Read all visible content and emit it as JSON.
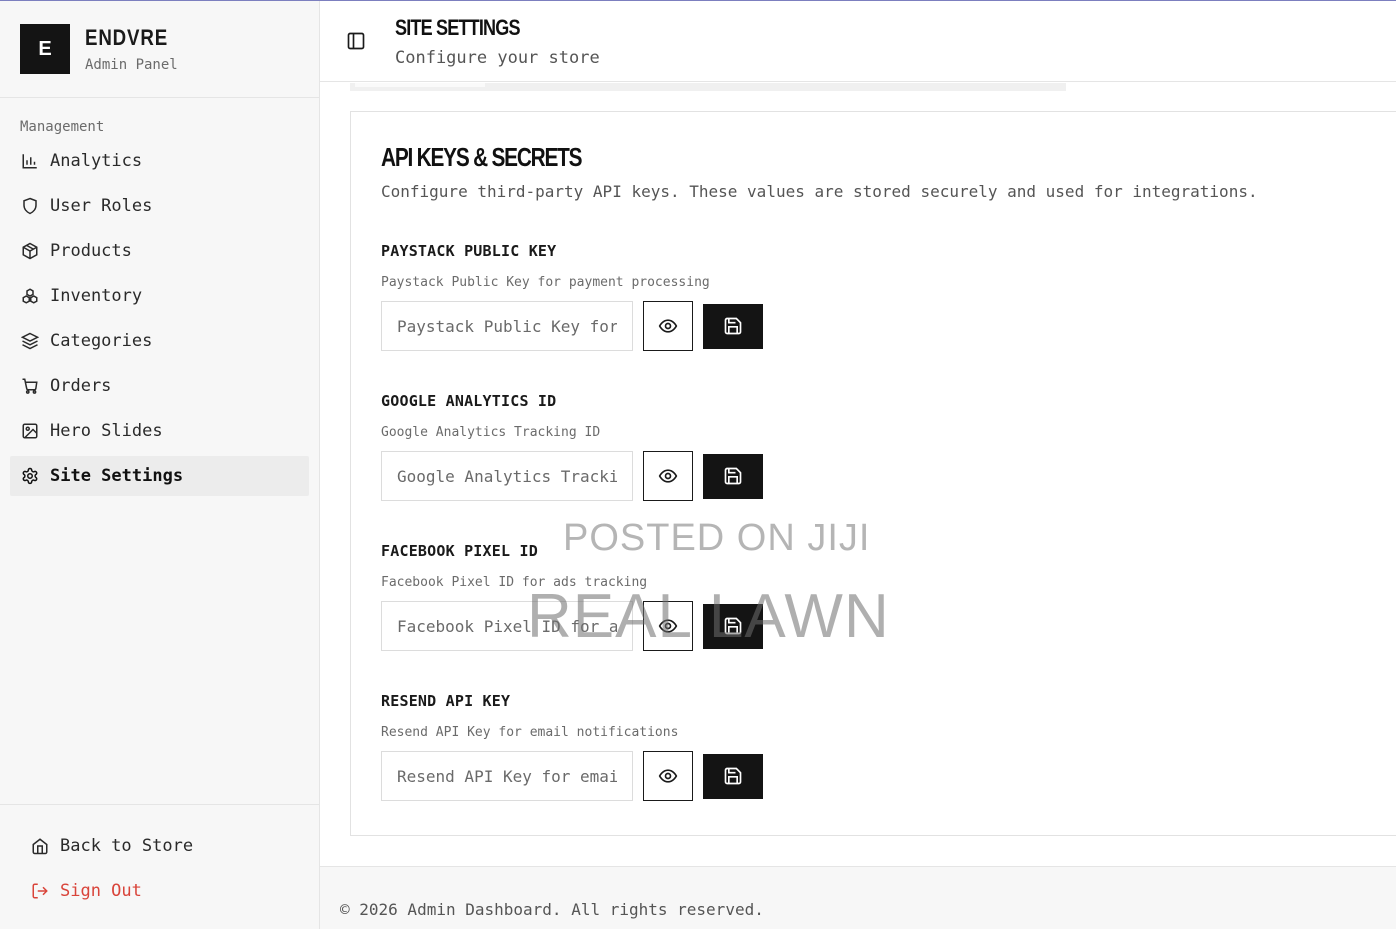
{
  "brand": {
    "logo_letter": "E",
    "name": "ENDVRE",
    "subtitle": "Admin Panel"
  },
  "sidebar": {
    "section_label": "Management",
    "items": [
      {
        "label": "Analytics",
        "icon": "bar-chart-icon"
      },
      {
        "label": "User Roles",
        "icon": "shield-icon"
      },
      {
        "label": "Products",
        "icon": "package-icon"
      },
      {
        "label": "Inventory",
        "icon": "boxes-icon"
      },
      {
        "label": "Categories",
        "icon": "layers-icon"
      },
      {
        "label": "Orders",
        "icon": "cart-icon"
      },
      {
        "label": "Hero Slides",
        "icon": "image-icon"
      },
      {
        "label": "Site Settings",
        "icon": "gear-icon",
        "active": true
      }
    ],
    "back_to_store": "Back to Store",
    "sign_out": "Sign Out"
  },
  "header": {
    "title": "SITE SETTINGS",
    "subtitle": "Configure your store"
  },
  "card": {
    "title": "API KEYS & SECRETS",
    "description": "Configure third-party API keys. These values are stored securely and used for integrations.",
    "fields": [
      {
        "label": "PAYSTACK PUBLIC KEY",
        "help": "Paystack Public Key for payment processing",
        "placeholder": "Paystack Public Key for payment processing",
        "value": ""
      },
      {
        "label": "GOOGLE ANALYTICS ID",
        "help": "Google Analytics Tracking ID",
        "placeholder": "Google Analytics Tracking ID",
        "value": ""
      },
      {
        "label": "FACEBOOK PIXEL ID",
        "help": "Facebook Pixel ID for ads tracking",
        "placeholder": "Facebook Pixel ID for ads tracking",
        "value": ""
      },
      {
        "label": "RESEND API KEY",
        "help": "Resend API Key for email notifications",
        "placeholder": "Resend API Key for email notifications",
        "value": ""
      }
    ]
  },
  "footer": {
    "text": "© 2026 Admin Dashboard. All rights reserved."
  },
  "watermark": {
    "line1": "POSTED ON JIJI",
    "line2": "REAL LAWN"
  },
  "colors": {
    "accent": "#141414",
    "danger": "#d9443a",
    "sidebar_bg": "#f7f7f7"
  }
}
